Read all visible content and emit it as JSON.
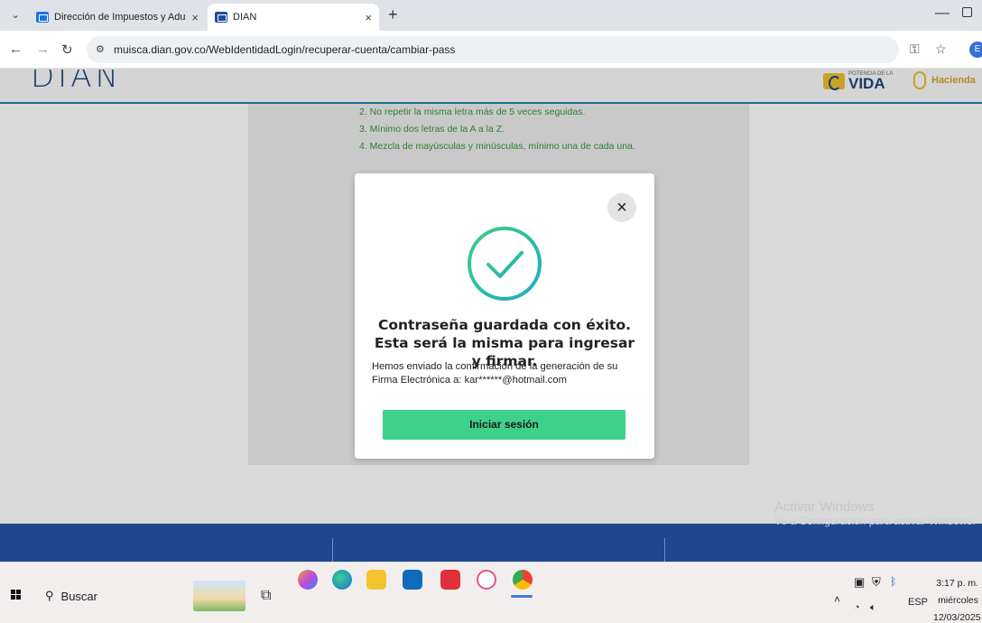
{
  "browser": {
    "tabs": [
      {
        "title": "Dirección de Impuestos y Adua",
        "active": false
      },
      {
        "title": "DIAN",
        "active": true
      }
    ],
    "url": "muisca.dian.gov.co/WebIdentidadLogin/recuperar-cuenta/cambiar-pass",
    "profile_initial": "E"
  },
  "header": {
    "logo": "DIAN",
    "vida_small": "POTENCIA DE LA",
    "vida_big": "VIDA",
    "hacienda": "Hacienda"
  },
  "rules": [
    "2. No repetir la misma letra más de 5 veces seguidas.",
    "3. Mínimo dos letras de la A a la Z.",
    "4. Mezcla de mayúsculas y minúsculas, mínimo una de cada una."
  ],
  "modal": {
    "title": "Contraseña guardada con éxito. Esta será la misma para ingresar y firmar.",
    "body": "Hemos enviado la confirmación de la generación de su Firma Electrónica a: kar******@hotmail.com",
    "button": "Iniciar sesión",
    "close_glyph": "×"
  },
  "watermark": {
    "line1": "Activar Windows",
    "line2": "Ve a Configuración para activar Windows."
  },
  "taskbar": {
    "search_label": "Buscar",
    "lang": "ESP",
    "time": "3:17 p. m.",
    "day": "miércoles",
    "date": "12/03/2025"
  },
  "colors": {
    "accent_green": "#3ed18a",
    "rules_green": "#2e7d32",
    "footer_blue": "#1f4690",
    "check_teal": "#2ec4a0"
  }
}
